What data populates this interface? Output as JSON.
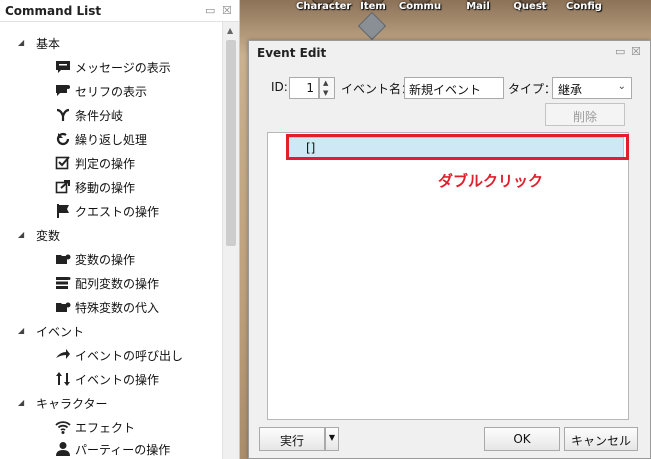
{
  "game_menu": {
    "items": [
      "Character",
      "Item",
      "Commu",
      "Mail",
      "Quest",
      "Config"
    ]
  },
  "command_list": {
    "title": "Command List",
    "controls": {
      "pin": "▭",
      "close": "☒"
    },
    "categories": [
      {
        "label": "基本",
        "items": [
          {
            "label": "メッセージの表示",
            "icon": "message-icon"
          },
          {
            "label": "セリフの表示",
            "icon": "speech-icon"
          },
          {
            "label": "条件分岐",
            "icon": "branch-icon"
          },
          {
            "label": "繰り返し処理",
            "icon": "loop-icon"
          },
          {
            "label": "判定の操作",
            "icon": "checkbox-icon"
          },
          {
            "label": "移動の操作",
            "icon": "move-icon"
          },
          {
            "label": "クエストの操作",
            "icon": "flag-icon"
          }
        ]
      },
      {
        "label": "変数",
        "items": [
          {
            "label": "変数の操作",
            "icon": "folder-gear-icon"
          },
          {
            "label": "配列変数の操作",
            "icon": "stack-icon"
          },
          {
            "label": "特殊変数の代入",
            "icon": "folder-gear-icon"
          }
        ]
      },
      {
        "label": "イベント",
        "items": [
          {
            "label": "イベントの呼び出し",
            "icon": "arrow-right-icon"
          },
          {
            "label": "イベントの操作",
            "icon": "updown-arrows-icon"
          }
        ]
      },
      {
        "label": "キャラクター",
        "items": [
          {
            "label": "エフェクト",
            "icon": "wifi-icon"
          },
          {
            "label": "パーティーの操作",
            "icon": "person-icon"
          }
        ]
      }
    ]
  },
  "event_edit": {
    "title": "Event Edit",
    "controls": {
      "pin": "▭",
      "close": "☒"
    },
    "id_label": "ID:",
    "id_value": "1",
    "name_label": "イベント名：",
    "name_value": "新規イベント",
    "type_label": "タイプ：",
    "type_value": "継承",
    "delete_label": "削除",
    "list_row_text": "[]",
    "annotation": "ダブルクリック",
    "exec_label": "実行",
    "ok_label": "OK",
    "cancel_label": "キャンセル"
  },
  "colors": {
    "annotation_red": "#e01e2e",
    "selection_blue": "#cfe8f6"
  }
}
